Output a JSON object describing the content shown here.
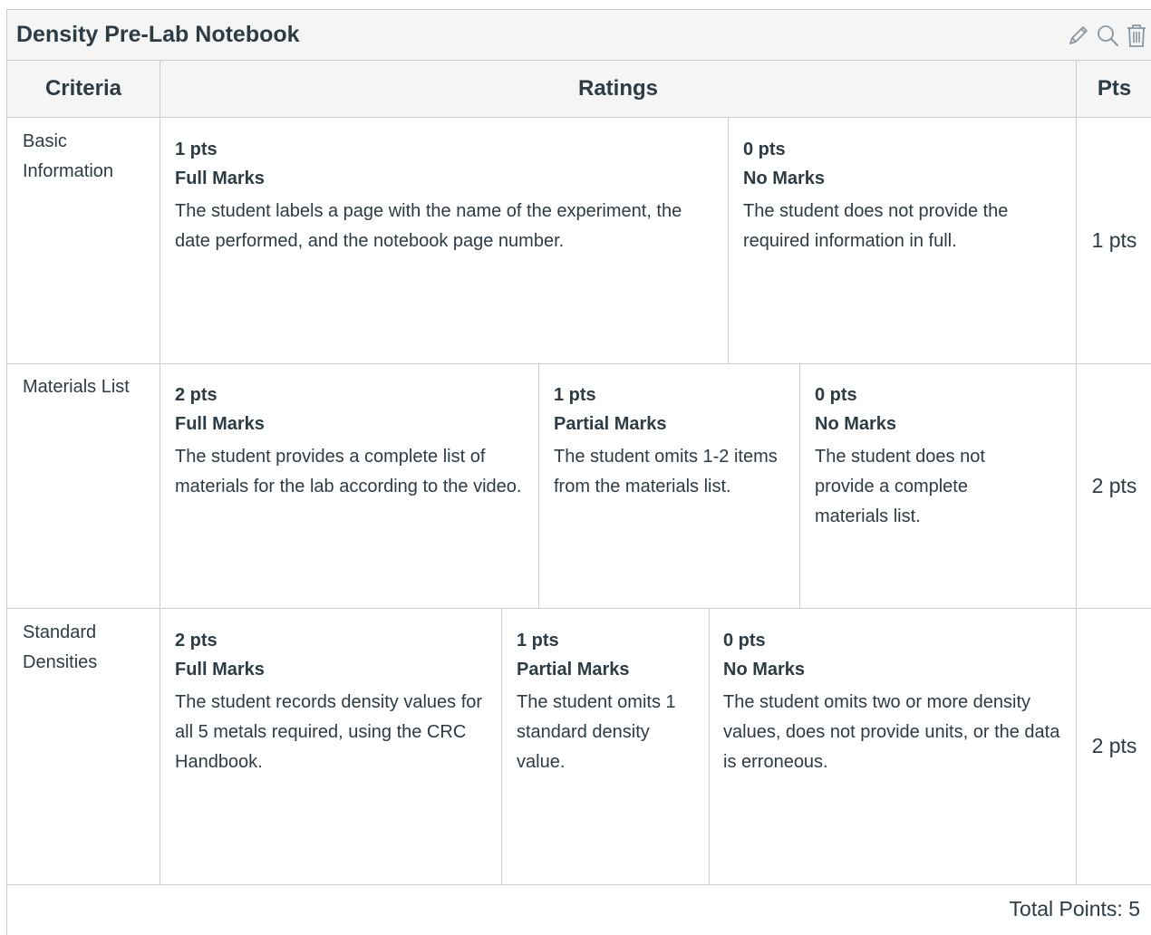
{
  "rubric": {
    "title": "Density Pre-Lab Notebook",
    "icons": [
      "pencil-icon",
      "search-icon",
      "trash-icon"
    ],
    "headers": {
      "criteria": "Criteria",
      "ratings": "Ratings",
      "pts": "Pts"
    },
    "criteria": [
      {
        "label": "Basic Information",
        "ratings": [
          {
            "pts": "1 pts",
            "name": "Full Marks",
            "description": "The student labels a page with the name of the experiment, the date performed, and the notebook page number."
          },
          {
            "pts": "0 pts",
            "name": "No Marks",
            "description": "The student does not provide the required information in full."
          }
        ],
        "points": "1 pts"
      },
      {
        "label": "Materials List",
        "ratings": [
          {
            "pts": "2 pts",
            "name": "Full Marks",
            "description": "The student provides a complete list of materials for the lab according to the video."
          },
          {
            "pts": "1 pts",
            "name": "Partial Marks",
            "description": "The student omits 1-2 items from the materials list."
          },
          {
            "pts": "0 pts",
            "name": "No Marks",
            "description": "The student does not provide a complete materials list."
          }
        ],
        "points": "2 pts"
      },
      {
        "label": "Standard Densities",
        "ratings": [
          {
            "pts": "2 pts",
            "name": "Full Marks",
            "description": "The student records density values for all 5 metals required, using the CRC Handbook."
          },
          {
            "pts": "1 pts",
            "name": "Partial Marks",
            "description": "The student omits 1 standard density value."
          },
          {
            "pts": "0 pts",
            "name": "No Marks",
            "description": "The student omits two or more density values, does not provide units, or the data is erroneous."
          }
        ],
        "points": "2 pts"
      }
    ],
    "total": "Total Points: 5"
  }
}
